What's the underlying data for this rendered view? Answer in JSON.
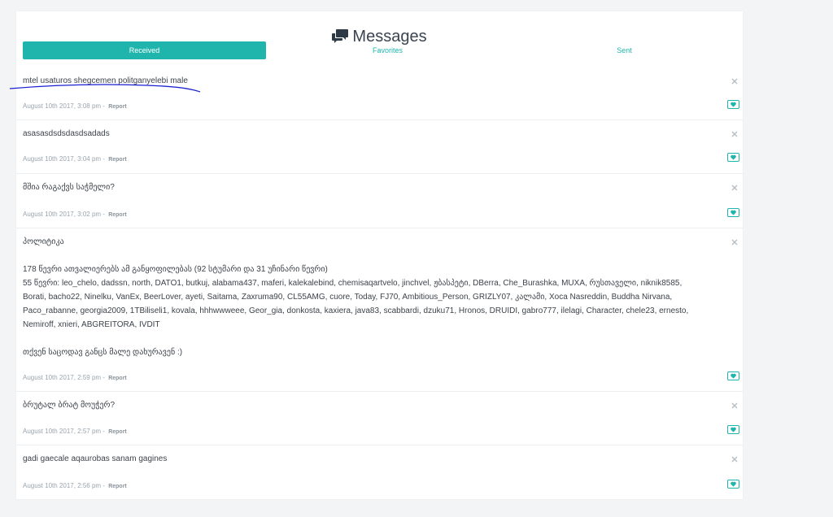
{
  "header": {
    "title": "Messages",
    "icon": "chat-bubbles-icon"
  },
  "tabs": [
    {
      "label": "Received",
      "active": true
    },
    {
      "label": "Favorites",
      "active": false
    },
    {
      "label": "Sent",
      "active": false
    }
  ],
  "colors": {
    "accent": "#1fb5ac",
    "annotation": "#1a1fd1"
  },
  "messages": [
    {
      "text": "mtel usaturos shegcemen politganyelebi male",
      "date": "August 10th 2017, 3:08 pm",
      "report": "Report"
    },
    {
      "text": "asasasdsdsdasdsadads",
      "date": "August 10th 2017, 3:04 pm",
      "report": "Report"
    },
    {
      "text": "მშია რაგაქვს საჭმელი?",
      "date": "August 10th 2017, 3:02 pm",
      "report": "Report"
    },
    {
      "text": "პოლიტიკა\n\n178 წევრი ათვალიერებს ამ განყოფილებას (92 სტუმარი და 31 უჩინარი წევრი)\n55 წევრი: leo_chelo, dadssn, north, DATO1, butkuj, alabama437, maferi, kalekalebind, chemisaqartvelo, jinchvel, ჟბასპეტი, DBerra, Che_Burashka, MUXA, რუსთაველი, niknik8585, Borati, bacho22, Ninelku, VanEx, BeerLover, ayeti, Saitama, Zaxruma90, CL55AMG, cuore, Today, FJ70, Ambitious_Person, GRIZLY07, კალამი, Xoca Nasreddin, Buddha Nirvana, Paco_rabanne, georgia2009, 1TBiliseli1, kovala, hhhwwweee, Geor_gia, donkosta, kaxiera, java83, scabbardi, dzuku71, Hronos, DRUIDI, gabro777, ilelagi, Character, chele23, ernesto, Nemiroff, xnieri, ABGREITORA, IVDIT\n\nთქვენ საცოდავ განცს მალე დახურავენ :)",
      "date": "August 10th 2017, 2:59 pm",
      "report": "Report"
    },
    {
      "text": "ბრუტალ ბრატ მოუჭერ?",
      "date": "August 10th 2017, 2:57 pm",
      "report": "Report"
    },
    {
      "text": "gadi gaecale aqaurobas sanam gagines",
      "date": "August 10th 2017, 2:56 pm",
      "report": "Report"
    }
  ]
}
